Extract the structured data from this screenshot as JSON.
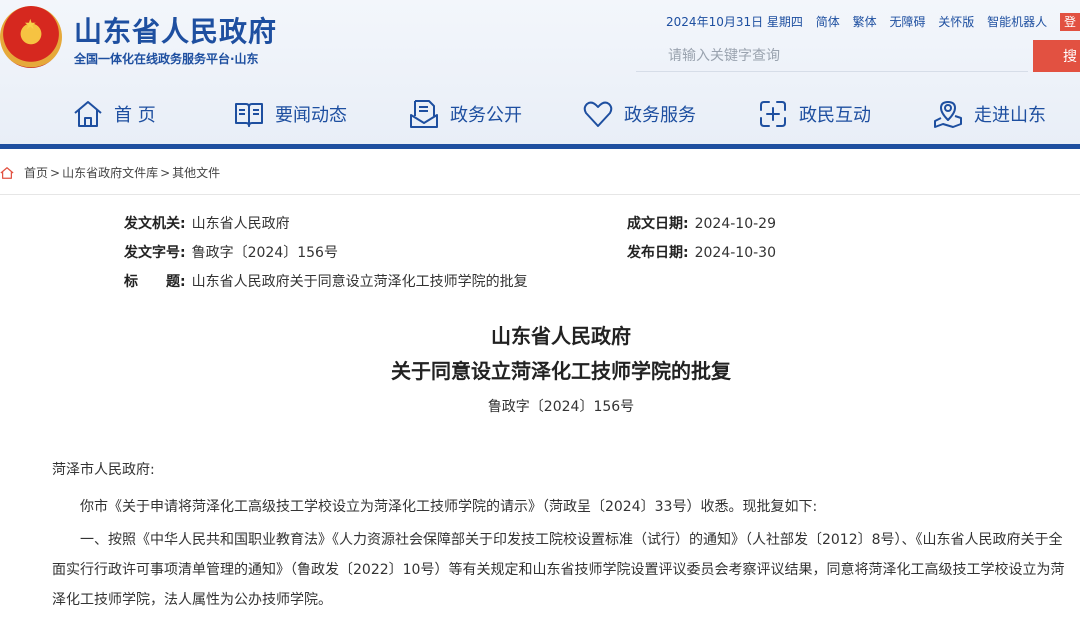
{
  "header": {
    "site_title": "山东省人民政府",
    "site_subtitle": "全国一体化在线政务服务平台·山东",
    "date": "2024年10月31日 星期四",
    "links": [
      "简体",
      "繁体",
      "无障碍",
      "关怀版",
      "智能机器人",
      "登"
    ],
    "search_placeholder": "请输入关键字查询",
    "search_button": "搜"
  },
  "nav": [
    {
      "label": "首 页",
      "icon": "home-icon"
    },
    {
      "label": "要闻动态",
      "icon": "book-icon"
    },
    {
      "label": "政务公开",
      "icon": "document-icon"
    },
    {
      "label": "政务服务",
      "icon": "heart-icon"
    },
    {
      "label": "政民互动",
      "icon": "interaction-icon"
    },
    {
      "label": "走进山东",
      "icon": "location-icon"
    }
  ],
  "breadcrumb": {
    "items": [
      "首页",
      "山东省政府文件库",
      "其他文件"
    ],
    "separator": ">"
  },
  "meta": {
    "issuer_label": "发文机关:",
    "issuer": "山东省人民政府",
    "number_label": "发文字号:",
    "number": "鲁政字〔2024〕156号",
    "title_label": "标　　题:",
    "title": "山东省人民政府关于同意设立菏泽化工技师学院的批复",
    "created_label": "成文日期:",
    "created": "2024-10-29",
    "published_label": "发布日期:",
    "published": "2024-10-30"
  },
  "document": {
    "title_line1": "山东省人民政府",
    "title_line2": "关于同意设立菏泽化工技师学院的批复",
    "doc_number": "鲁政字〔2024〕156号",
    "salutation": "菏泽市人民政府:",
    "para1": "你市《关于申请将菏泽化工高级技工学校设立为菏泽化工技师学院的请示》（菏政呈〔2024〕33号）收悉。现批复如下:",
    "para2": "一、按照《中华人民共和国职业教育法》《人力资源社会保障部关于印发技工院校设置标准（试行）的通知》（人社部发〔2012〕8号）、《山东省人民政府关于全面实行行政许可事项清单管理的通知》（鲁政发〔2022〕10号）等有关规定和山东省技师学院设置评议委员会考察评议结果，同意将菏泽化工高级技工学校设立为菏泽化工技师学院，法人属性为公办技师学院。"
  },
  "colors": {
    "brand_blue": "#1e4fa0",
    "search_red": "#e25141",
    "header_bg": "#eef2f8"
  }
}
